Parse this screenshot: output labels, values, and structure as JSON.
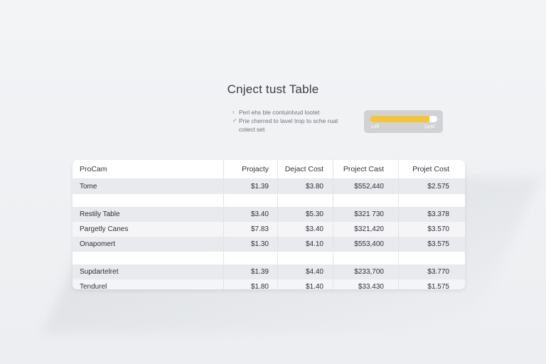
{
  "page": {
    "title": "Cnject tust Table"
  },
  "notes": {
    "items": [
      {
        "marker": "›",
        "text": "Perl ehs ble contuinlvud lootet"
      },
      {
        "marker": "✓",
        "text": "Prie cherred to lavel trop to sche ruat"
      }
    ],
    "continuation": "cotect set"
  },
  "progress": {
    "level_percent": 88,
    "min_label": "Lell",
    "max_label": "Ucid",
    "fill_color": "#f4c43a"
  },
  "table": {
    "columns": [
      "ProCam",
      "Projacty",
      "Dejact Cost",
      "Project Cast",
      "Projet Cost"
    ],
    "rows": [
      {
        "cells": [
          "Tome",
          "$1.39",
          "$3.80",
          "$552,440",
          "$2.575"
        ]
      },
      {
        "cells": [
          "",
          "",
          "",
          "",
          ""
        ]
      },
      {
        "cells": [
          "Restily Table",
          "$3.40",
          "$5.30",
          "$321 730",
          "$3.378"
        ]
      },
      {
        "cells": [
          "Pargetly Canes",
          "$7.83",
          "$3.40",
          "$321,420",
          "$3.570"
        ]
      },
      {
        "cells": [
          "Onapomert",
          "$1.30",
          "$4.10",
          "$553,400",
          "$3.575"
        ]
      },
      {
        "cells": [
          "",
          "",
          "",
          "",
          ""
        ]
      },
      {
        "cells": [
          "Supdartelret",
          "$1.39",
          "$4.40",
          "$233,700",
          "$3.770"
        ]
      },
      {
        "cells": [
          "Tendurel",
          "$1.80",
          "$1.40",
          "$33.430",
          "$1.575"
        ]
      }
    ]
  }
}
